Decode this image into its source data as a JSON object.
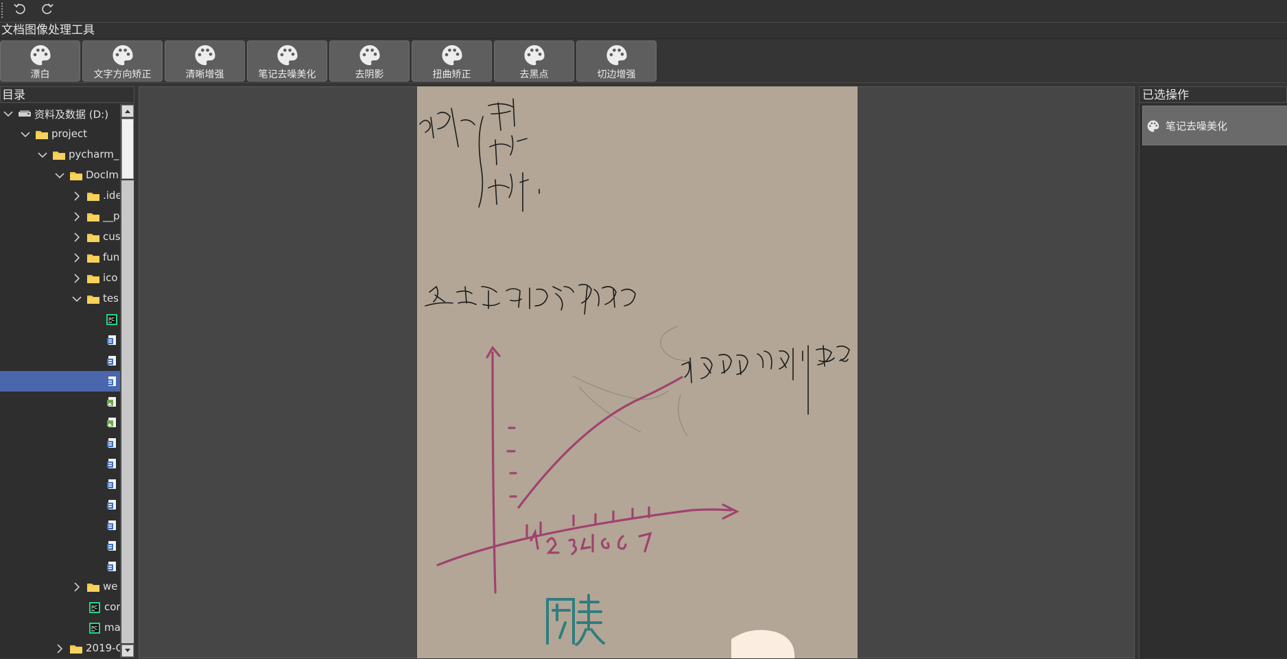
{
  "toolbar": {
    "quick_actions": [
      {
        "name": "undo-icon",
        "label": ""
      },
      {
        "name": "redo-icon",
        "label": ""
      }
    ]
  },
  "ribbon": {
    "title": "文档图像处理工具",
    "tools": [
      {
        "label": "漂白"
      },
      {
        "label": "文字方向矫正"
      },
      {
        "label": "清晰增强"
      },
      {
        "label": "笔记去噪美化"
      },
      {
        "label": "去阴影"
      },
      {
        "label": "扭曲矫正"
      },
      {
        "label": "去黑点"
      },
      {
        "label": "切边增强"
      }
    ]
  },
  "directory": {
    "title": "目录",
    "rows": [
      {
        "label": "资料及数据 (D:)",
        "expanded": true,
        "icon": "drive-icon"
      },
      {
        "label": "project",
        "expanded": true,
        "icon": "folder-icon"
      },
      {
        "label": "pycharm_",
        "expanded": true,
        "icon": "folder-icon"
      },
      {
        "label": "DocIm",
        "expanded": true,
        "icon": "folder-icon"
      },
      {
        "label": ".ide",
        "expanded": false,
        "icon": "folder-icon"
      },
      {
        "label": "__p",
        "expanded": false,
        "icon": "folder-icon"
      },
      {
        "label": "cus",
        "expanded": false,
        "icon": "folder-icon"
      },
      {
        "label": "fun",
        "expanded": false,
        "icon": "folder-icon"
      },
      {
        "label": "ico",
        "expanded": false,
        "icon": "folder-icon"
      },
      {
        "label": "tes",
        "expanded": true,
        "icon": "folder-icon"
      },
      {
        "label": "",
        "icon": "pycharm-file-icon"
      },
      {
        "label": "",
        "icon": "document-file-icon"
      },
      {
        "label": "",
        "icon": "document-file-icon"
      },
      {
        "label": "",
        "icon": "document-file-icon",
        "selected": true
      },
      {
        "label": "",
        "icon": "image-file-icon"
      },
      {
        "label": "",
        "icon": "image-file-icon"
      },
      {
        "label": "",
        "icon": "document-file-icon"
      },
      {
        "label": "",
        "icon": "document-file-icon"
      },
      {
        "label": "",
        "icon": "document-file-icon"
      },
      {
        "label": "",
        "icon": "document-file-icon"
      },
      {
        "label": "",
        "icon": "document-file-icon"
      },
      {
        "label": "",
        "icon": "document-file-icon"
      },
      {
        "label": "",
        "icon": "document-file-icon"
      },
      {
        "label": "we",
        "expanded": false,
        "icon": "folder-icon"
      },
      {
        "label": "cor",
        "icon": "pycharm-file-icon"
      },
      {
        "label": "ma",
        "icon": "pycharm-file-icon"
      },
      {
        "label": "2019-C",
        "expanded": false,
        "icon": "folder-icon"
      }
    ]
  },
  "selected_ops": {
    "title": "已选操作",
    "items": [
      {
        "label": "笔记去噪美化",
        "icon": "palette-icon"
      }
    ]
  },
  "colors": {
    "bg": "#353535",
    "panel": "#2e2e2e",
    "tool_button": "#5e5e5e",
    "selection": "#4a66ad",
    "paper": "#b3a696",
    "ink_magenta": "#a0426f",
    "ink_teal": "#2f7d80"
  }
}
